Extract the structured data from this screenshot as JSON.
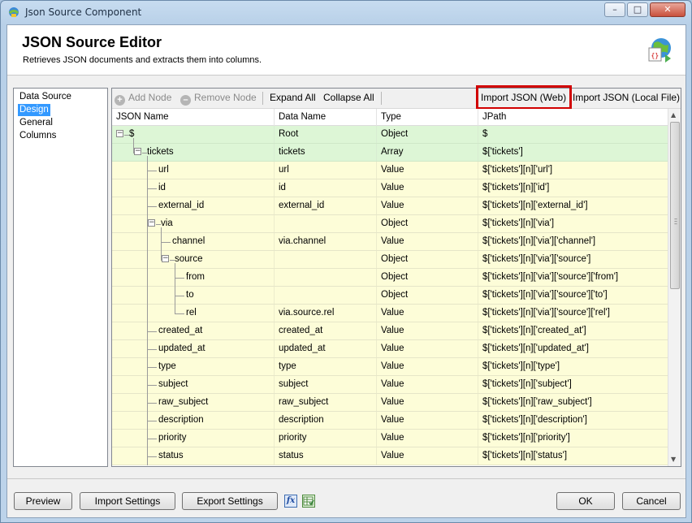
{
  "window": {
    "title": "Json Source Component",
    "controls": [
      "minimize",
      "maximize",
      "close"
    ]
  },
  "header": {
    "title": "JSON Source Editor",
    "subtitle": "Retrieves JSON documents and extracts them into columns.",
    "icon": "json-globe-icon"
  },
  "nav": {
    "items": [
      {
        "label": "Data Source",
        "selected": false
      },
      {
        "label": "Design",
        "selected": true
      },
      {
        "label": "General",
        "selected": false
      },
      {
        "label": "Columns",
        "selected": false
      }
    ]
  },
  "toolbar": {
    "add_node": "Add Node",
    "remove_node": "Remove Node",
    "expand_all": "Expand All",
    "collapse_all": "Collapse All",
    "import_web": "Import JSON (Web)",
    "import_file": "Import JSON (Local File)"
  },
  "grid": {
    "columns": [
      "JSON Name",
      "Data Name",
      "Type",
      "JPath"
    ],
    "rows": [
      {
        "name": "$",
        "data": "Root",
        "type": "Object",
        "path": "$",
        "depth": 0,
        "expander": "minus",
        "root": true,
        "last": true
      },
      {
        "name": "tickets",
        "data": "tickets",
        "type": "Array",
        "path": "$['tickets']",
        "depth": 1,
        "expander": "minus",
        "root": true,
        "last": true
      },
      {
        "name": "url",
        "data": "url",
        "type": "Value",
        "path": "$['tickets'][n]['url']",
        "depth": 2
      },
      {
        "name": "id",
        "data": "id",
        "type": "Value",
        "path": "$['tickets'][n]['id']",
        "depth": 2
      },
      {
        "name": "external_id",
        "data": "external_id",
        "type": "Value",
        "path": "$['tickets'][n]['external_id']",
        "depth": 2
      },
      {
        "name": "via",
        "data": "",
        "type": "Object",
        "path": "$['tickets'][n]['via']",
        "depth": 2,
        "expander": "minus"
      },
      {
        "name": "channel",
        "data": "via.channel",
        "type": "Value",
        "path": "$['tickets'][n]['via']['channel']",
        "depth": 3
      },
      {
        "name": "source",
        "data": "",
        "type": "Object",
        "path": "$['tickets'][n]['via']['source']",
        "depth": 3,
        "expander": "minus",
        "last": true
      },
      {
        "name": "from",
        "data": "",
        "type": "Object",
        "path": "$['tickets'][n]['via']['source']['from']",
        "depth": 4
      },
      {
        "name": "to",
        "data": "",
        "type": "Object",
        "path": "$['tickets'][n]['via']['source']['to']",
        "depth": 4
      },
      {
        "name": "rel",
        "data": "via.source.rel",
        "type": "Value",
        "path": "$['tickets'][n]['via']['source']['rel']",
        "depth": 4,
        "last": true
      },
      {
        "name": "created_at",
        "data": "created_at",
        "type": "Value",
        "path": "$['tickets'][n]['created_at']",
        "depth": 2
      },
      {
        "name": "updated_at",
        "data": "updated_at",
        "type": "Value",
        "path": "$['tickets'][n]['updated_at']",
        "depth": 2
      },
      {
        "name": "type",
        "data": "type",
        "type": "Value",
        "path": "$['tickets'][n]['type']",
        "depth": 2
      },
      {
        "name": "subject",
        "data": "subject",
        "type": "Value",
        "path": "$['tickets'][n]['subject']",
        "depth": 2
      },
      {
        "name": "raw_subject",
        "data": "raw_subject",
        "type": "Value",
        "path": "$['tickets'][n]['raw_subject']",
        "depth": 2
      },
      {
        "name": "description",
        "data": "description",
        "type": "Value",
        "path": "$['tickets'][n]['description']",
        "depth": 2
      },
      {
        "name": "priority",
        "data": "priority",
        "type": "Value",
        "path": "$['tickets'][n]['priority']",
        "depth": 2
      },
      {
        "name": "status",
        "data": "status",
        "type": "Value",
        "path": "$['tickets'][n]['status']",
        "depth": 2
      }
    ]
  },
  "footer": {
    "preview": "Preview",
    "import_settings": "Import Settings",
    "export_settings": "Export Settings",
    "fx_icon": "fx",
    "ok": "OK",
    "cancel": "Cancel"
  },
  "colors": {
    "root_row": "#ddf6d6",
    "row": "#fdfdd8",
    "selection": "#3399ff",
    "highlight": "#d10000"
  }
}
